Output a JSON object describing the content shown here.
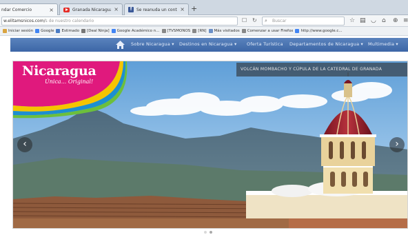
{
  "browser": {
    "tabs": [
      {
        "label": "ndar Comercio",
        "favicon": "site-icon"
      },
      {
        "label": "Granada Nicaragua - You...",
        "favicon": "youtube-icon"
      },
      {
        "label": "Se reanuda un control de...",
        "favicon": "facebook-icon"
      }
    ],
    "new_tab_label": "+",
    "url": "w.elitamsnicos.com/",
    "url_hint": "s de nuestro calendario",
    "search_placeholder": "Buscar",
    "bookmarks": [
      {
        "label": "Iniciar sesión",
        "color": "#d9a441"
      },
      {
        "label": "Google",
        "color": "#4285f4"
      },
      {
        "label": "Estimado",
        "color": "#4a7bc4"
      },
      {
        "label": "[Deal Ninja]",
        "color": "#777777"
      },
      {
        "label": "Google Académico n...",
        "color": "#4285f4"
      },
      {
        "label": "[TVSMONOS",
        "color": "#888888"
      },
      {
        "label": "[RN]",
        "color": "#888888"
      },
      {
        "label": "Más visitados",
        "color": "#6a8fc7"
      },
      {
        "label": "Comenzar a usar Firefox",
        "color": "#888888"
      },
      {
        "label": "http://www.google.c...",
        "color": "#4285f4"
      }
    ]
  },
  "site": {
    "menu": [
      {
        "label": "Sobre Nicaragua ▾"
      },
      {
        "label": "Destinos en Nicaragua ▾"
      },
      {
        "label": "Oferta Turística"
      },
      {
        "label": "Departamentos de Nicaragua ▾"
      },
      {
        "label": "Multimedia ▾"
      }
    ],
    "logo_title": "Nicaragua",
    "logo_tagline": "Única... Original!",
    "slide_caption": "VOLCÁN MOMBACHO Y CÚPULA DE LA CATEDRAL DE GRANADA",
    "prev_label": "‹",
    "next_label": "›",
    "slide_count": 2,
    "active_slide": 2
  },
  "colors": {
    "menu_bar": "#3c66a6",
    "logo_pink": "#e0197d",
    "logo_yellow": "#f5c400",
    "logo_blue": "#1d8fd0",
    "logo_green": "#6cbf3c"
  }
}
